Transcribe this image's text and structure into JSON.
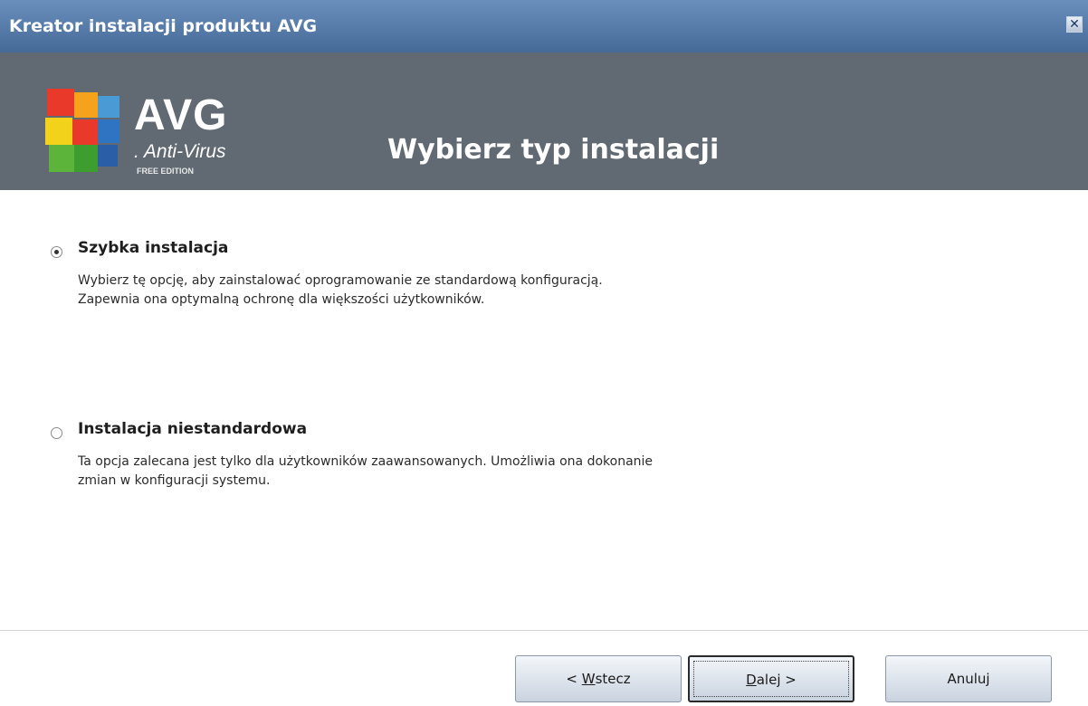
{
  "window": {
    "title": "Kreator instalacji produktu AVG",
    "close_icon": "close-icon"
  },
  "header": {
    "logo_brand": "AVG",
    "logo_brand_suffix": ".",
    "logo_product": ". Anti-Virus",
    "logo_edition": "FREE EDITION",
    "page_title": "Wybierz typ instalacji",
    "background": "#616a72"
  },
  "options": [
    {
      "label": "Szybka instalacja",
      "selected": true,
      "description_line1": "Wybierz tę opcję, aby zainstalować oprogramowanie ze standardową konfiguracją.",
      "description_line2": "Zapewnia ona optymalną ochronę dla większości użytkowników."
    },
    {
      "label": "Instalacja niestandardowa",
      "selected": false,
      "description_line1": "Ta opcja zalecana jest tylko dla użytkowników zaawansowanych. Umożliwia ona dokonanie",
      "description_line2": "zmian w konfiguracji systemu."
    }
  ],
  "buttons": {
    "back_prefix": "< ",
    "back_accel": "W",
    "back_rest": "stecz",
    "next_accel": "D",
    "next_rest": "alej >",
    "cancel": "Anuluj"
  },
  "colors": {
    "titlebar": "#4f75a3",
    "header": "#616a72"
  }
}
